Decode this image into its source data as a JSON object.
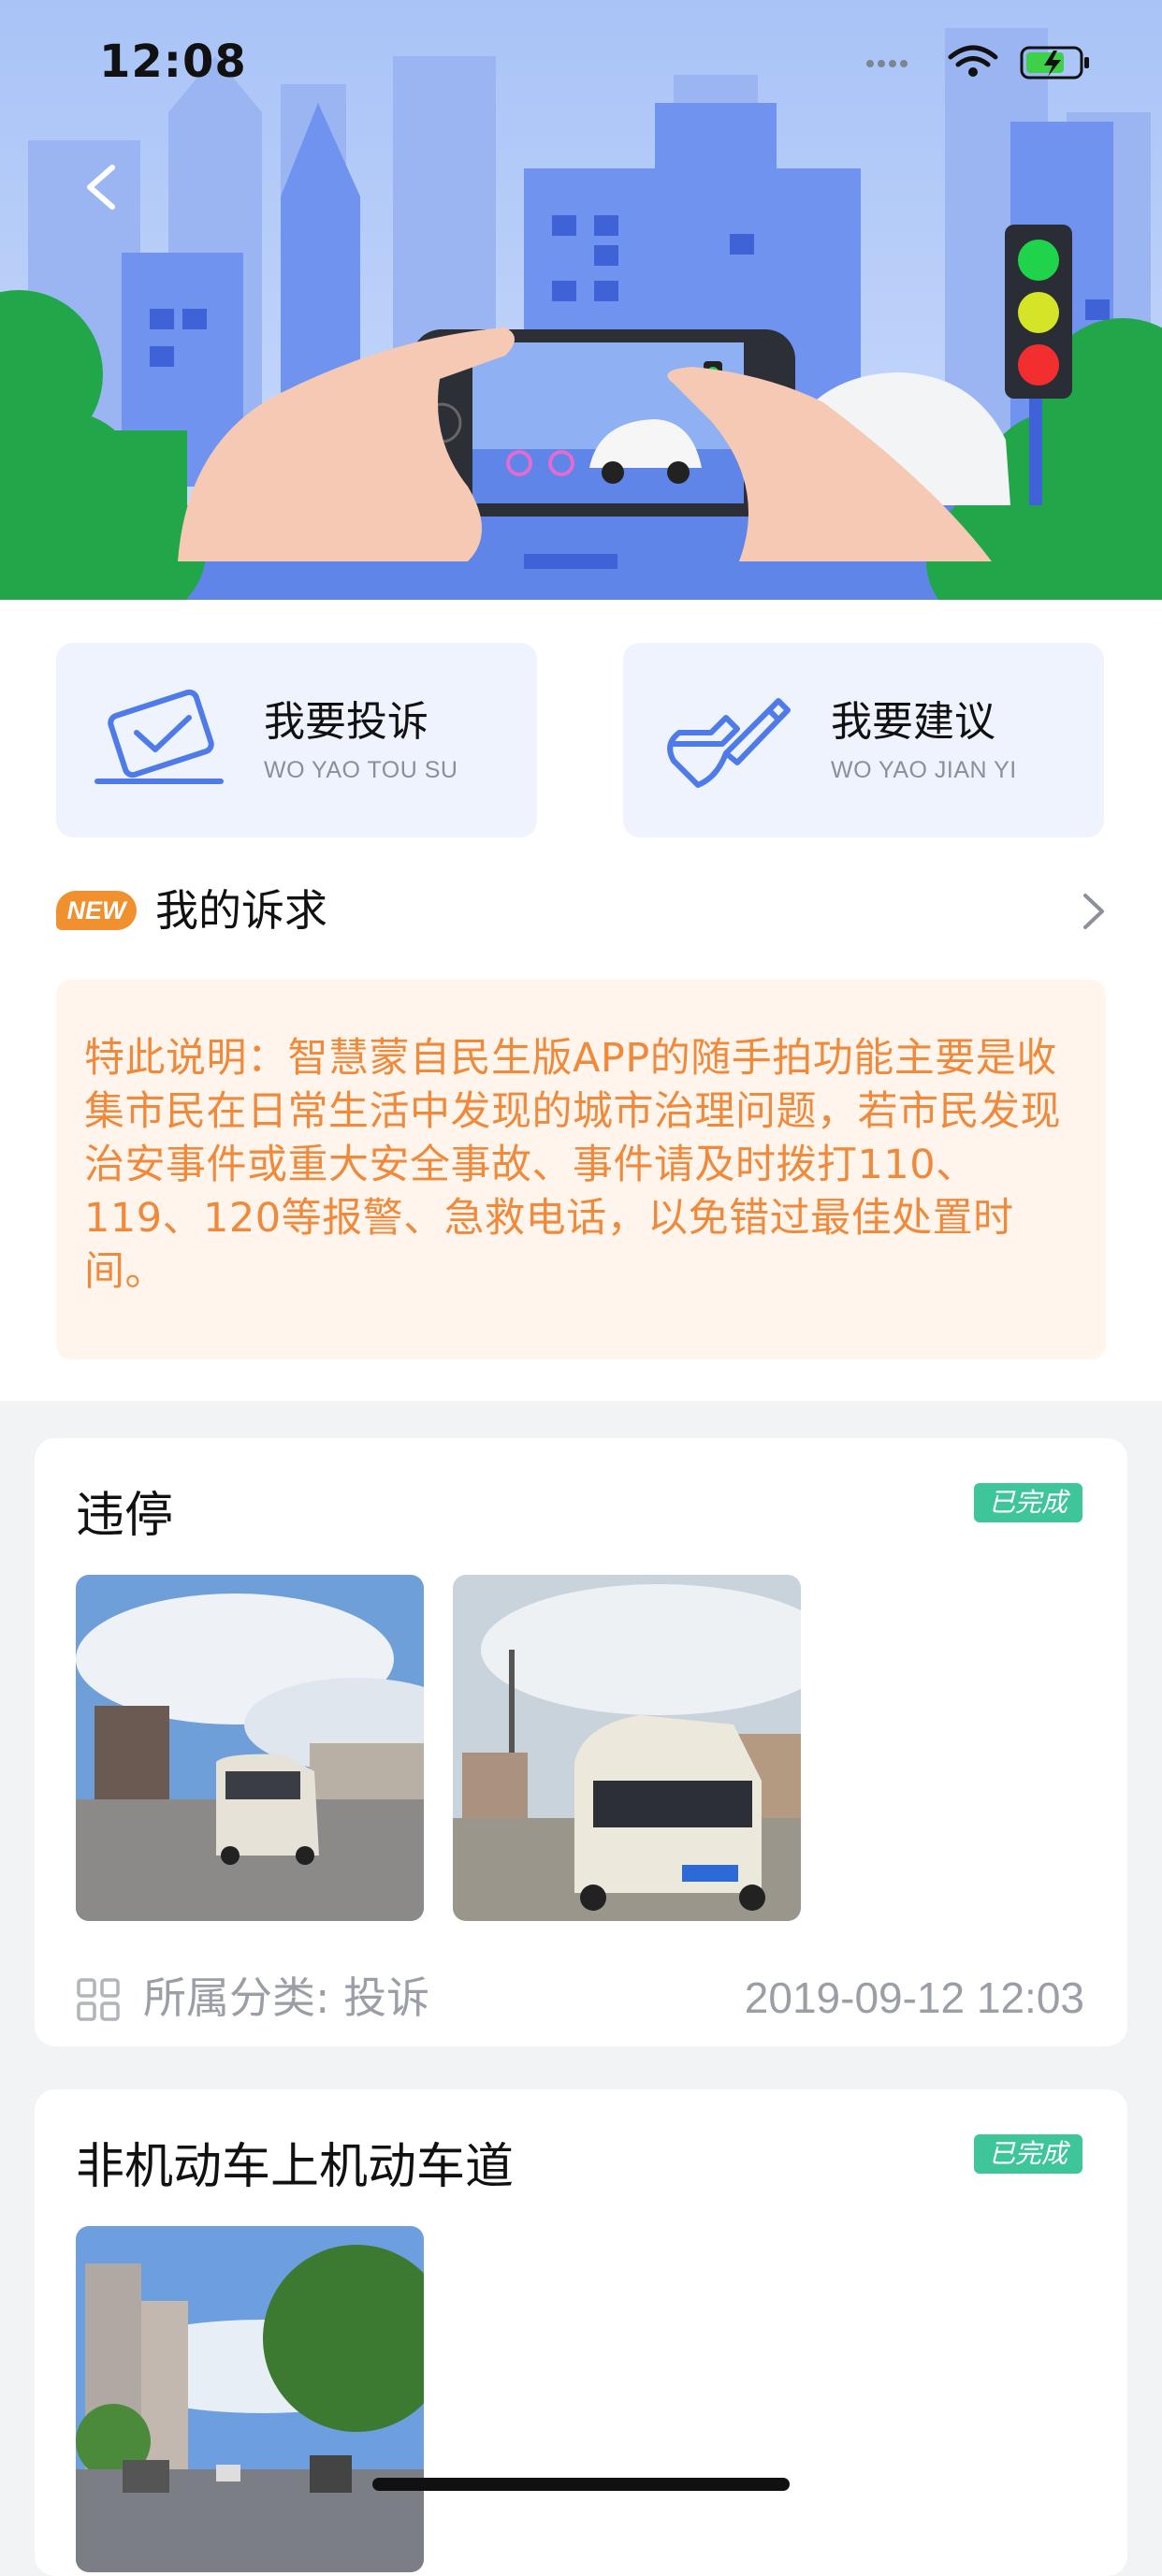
{
  "status_bar": {
    "time": "12:08"
  },
  "actions": [
    {
      "title": "我要投诉",
      "subtitle": "WO YAO TOU SU"
    },
    {
      "title": "我要建议",
      "subtitle": "WO YAO JIAN YI"
    }
  ],
  "my_requests": {
    "badge": "NEW",
    "label": "我的诉求"
  },
  "notice": "特此说明：智慧蒙自民生版APP的随手拍功能主要是收集市民在日常生活中发现的城市治理问题，若市民发现治安事件或重大安全事故、事件请及时拨打110、119、120等报警、急救电话，以免错过最佳处置时间。",
  "records": [
    {
      "title": "违停",
      "status": "已完成",
      "category": "所属分类: 投诉",
      "time": "2019-09-12 12:03"
    },
    {
      "title": "非机动车上机动车道",
      "status": "已完成"
    }
  ],
  "colors": {
    "accent_blue": "#4f7be8",
    "notice_text": "#ef8a3c",
    "notice_bg": "#fff5ed",
    "badge_orange": "#f0902f",
    "status_green": "#3fc59a"
  },
  "icons": [
    "back-arrow-icon",
    "complaint-icon",
    "suggestion-icon",
    "chevron-right-icon",
    "category-grid-icon",
    "wifi-icon",
    "battery-icon",
    "signal-icon"
  ]
}
